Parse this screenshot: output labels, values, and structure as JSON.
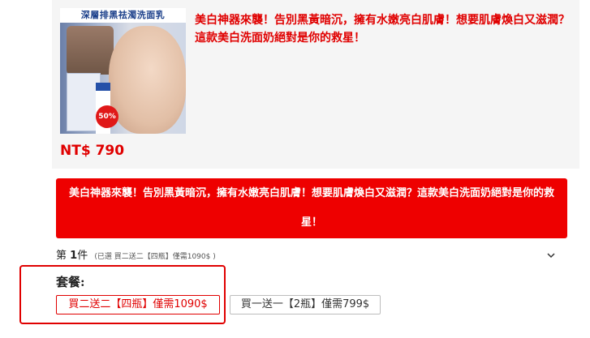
{
  "product": {
    "image_banner": "深層排黑祛濁洗面乳",
    "image_badge": "50% OFF",
    "description": "美白神器來襲！告別黑黃暗沉，擁有水嫩亮白肌膚！想要肌膚煥白又滋潤？這款美白洗面奶絕對是你的救星！",
    "price": "NT$ 790"
  },
  "promo": {
    "text": "美白神器來襲！告別黑黃暗沉，擁有水嫩亮白肌膚！想要肌膚煥白又滋潤？這款美白洗面奶絕對是你的救星！"
  },
  "item": {
    "prefix": "第",
    "number": "1",
    "suffix": "件",
    "selected_note": "(已選 買二送二【四瓶】僅需1090$ )"
  },
  "package": {
    "label": "套餐:",
    "options": [
      {
        "label": "買二送二【四瓶】僅需1090$",
        "selected": true
      },
      {
        "label": "買一送一【2瓶】僅需799$",
        "selected": false
      }
    ]
  },
  "colors": {
    "accent": "#e00000",
    "banner_bg": "#ee0000",
    "card_bg": "#f5f5f5"
  },
  "icons": {
    "expand": "chevron-down-icon"
  }
}
